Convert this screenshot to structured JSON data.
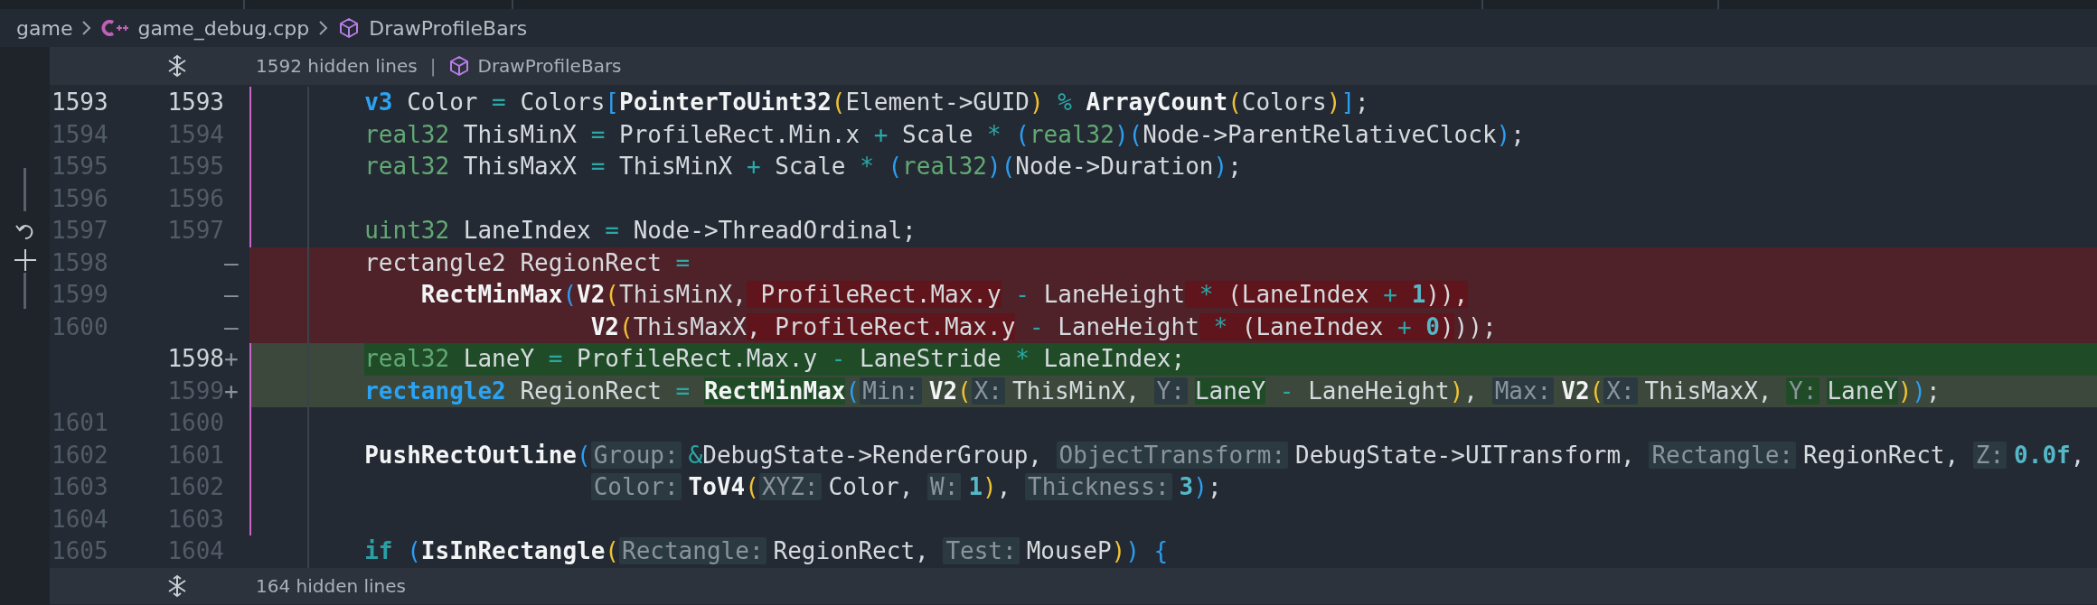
{
  "breadcrumb": [
    {
      "label": "game",
      "kind": "folder"
    },
    {
      "label": "game_debug.cpp",
      "kind": "file"
    },
    {
      "label": "DrawProfileBars",
      "kind": "symbol"
    }
  ],
  "hidden_top": {
    "text": "1592 hidden lines",
    "separator": "|",
    "symbol": "DrawProfileBars"
  },
  "lines": [
    {
      "old": "1593",
      "new": "1593",
      "kind": "statement",
      "removed": false,
      "added": false,
      "active": true,
      "marked": true,
      "tokens": [
        {
          "text": "v3",
          "kind": "keyword"
        },
        {
          "text": " Color ",
          "kind": "text"
        },
        {
          "text": "=",
          "kind": "operator"
        },
        {
          "text": " Colors",
          "kind": "text"
        },
        {
          "text": "[",
          "kind": "paren2"
        },
        {
          "text": "PointerToUint32",
          "kind": "function"
        },
        {
          "text": "(",
          "kind": "paren1"
        },
        {
          "text": "Element->GUID",
          "kind": "text"
        },
        {
          "text": ")",
          "kind": "paren1"
        },
        {
          "text": " % ",
          "kind": "operator"
        },
        {
          "text": "ArrayCount",
          "kind": "function"
        },
        {
          "text": "(",
          "kind": "paren1"
        },
        {
          "text": "Colors",
          "kind": "text"
        },
        {
          "text": ")",
          "kind": "paren1"
        },
        {
          "text": "]",
          "kind": "paren2"
        },
        {
          "text": ";",
          "kind": "text"
        }
      ]
    },
    {
      "old": "1594",
      "new": "1594",
      "kind": "statement",
      "removed": false,
      "added": false,
      "active": false,
      "marked": true,
      "tokens": [
        {
          "text": "real32",
          "kind": "type"
        },
        {
          "text": " ThisMinX ",
          "kind": "text"
        },
        {
          "text": "=",
          "kind": "operator"
        },
        {
          "text": " ProfileRect.Min.x ",
          "kind": "text"
        },
        {
          "text": "+",
          "kind": "operator"
        },
        {
          "text": " Scale ",
          "kind": "text"
        },
        {
          "text": "* ",
          "kind": "operator"
        },
        {
          "text": "(",
          "kind": "paren2"
        },
        {
          "text": "real32",
          "kind": "type"
        },
        {
          "text": ")(",
          "kind": "paren2"
        },
        {
          "text": "Node->ParentRelativeClock",
          "kind": "text"
        },
        {
          "text": ")",
          "kind": "paren2"
        },
        {
          "text": ";",
          "kind": "text"
        }
      ]
    },
    {
      "old": "1595",
      "new": "1595",
      "kind": "statement",
      "removed": false,
      "added": false,
      "active": false,
      "marked": true,
      "tokens": [
        {
          "text": "real32",
          "kind": "type"
        },
        {
          "text": " ThisMaxX ",
          "kind": "text"
        },
        {
          "text": "=",
          "kind": "operator"
        },
        {
          "text": " ThisMinX ",
          "kind": "text"
        },
        {
          "text": "+",
          "kind": "operator"
        },
        {
          "text": " Scale ",
          "kind": "text"
        },
        {
          "text": "* ",
          "kind": "operator"
        },
        {
          "text": "(",
          "kind": "paren2"
        },
        {
          "text": "real32",
          "kind": "type"
        },
        {
          "text": ")(",
          "kind": "paren2"
        },
        {
          "text": "Node->Duration",
          "kind": "text"
        },
        {
          "text": ")",
          "kind": "paren2"
        },
        {
          "text": ";",
          "kind": "text"
        }
      ]
    },
    {
      "old": "1596",
      "new": "1596",
      "kind": "statement",
      "removed": false,
      "added": false,
      "active": false,
      "marked": true
    },
    {
      "old": "1597",
      "new": "1597",
      "kind": "statement",
      "removed": false,
      "added": false,
      "active": false,
      "marked": true,
      "tokens": [
        {
          "text": "uint32",
          "kind": "type"
        },
        {
          "text": " LaneIndex ",
          "kind": "text"
        },
        {
          "text": "=",
          "kind": "operator"
        },
        {
          "text": " Node->ThreadOrdinal;",
          "kind": "text"
        }
      ]
    },
    {
      "old": "1598",
      "mark": "—",
      "kind": "statement",
      "removed": true,
      "added": false,
      "active": false,
      "marked": false,
      "tokens": [
        {
          "text": "rectangle2 RegionRect ",
          "kind": "text",
          "changed": false
        },
        {
          "text": "=",
          "kind": "operator",
          "changed": false
        }
      ]
    },
    {
      "old": "1599",
      "mark": "—",
      "kind": "continuation",
      "removed": true,
      "added": false,
      "active": false,
      "marked": false,
      "tokens": [
        {
          "text": "RectMinMax",
          "kind": "function",
          "changed": false
        },
        {
          "text": "(",
          "kind": "paren2",
          "changed": false
        },
        {
          "text": "V2",
          "kind": "function",
          "changed": false
        },
        {
          "text": "(",
          "kind": "paren1",
          "changed": false
        },
        {
          "text": "ThisMinX,",
          "kind": "text",
          "changed": false
        },
        {
          "text": " ProfileRect.Max.y",
          "kind": "text",
          "changed": true
        },
        {
          "text": " - ",
          "kind": "operator",
          "changed": false
        },
        {
          "text": "LaneHeight",
          "kind": "text",
          "changed": false
        },
        {
          "text": " * ",
          "kind": "operator",
          "changed": true
        },
        {
          "text": "(LaneIndex ",
          "kind": "text",
          "changed": true
        },
        {
          "text": "+ ",
          "kind": "operator",
          "changed": true
        },
        {
          "text": "1",
          "kind": "number",
          "changed": true
        },
        {
          "text": ")),",
          "kind": "text",
          "changed": true
        }
      ]
    },
    {
      "old": "1600",
      "mark": "—",
      "kind": "aligned",
      "removed": true,
      "added": false,
      "active": false,
      "marked": false,
      "tokens": [
        {
          "text": "V2",
          "kind": "function",
          "changed": false
        },
        {
          "text": "(",
          "kind": "paren1",
          "changed": false
        },
        {
          "text": "ThisMaxX",
          "kind": "text",
          "changed": false
        },
        {
          "text": ", ProfileRect.Max.y",
          "kind": "text",
          "changed": true
        },
        {
          "text": " - ",
          "kind": "operator",
          "changed": false
        },
        {
          "text": "LaneHeight",
          "kind": "text",
          "changed": false
        },
        {
          "text": " * ",
          "kind": "operator",
          "changed": true
        },
        {
          "text": "(LaneIndex ",
          "kind": "text",
          "changed": true
        },
        {
          "text": "+ ",
          "kind": "operator",
          "changed": true
        },
        {
          "text": "0",
          "kind": "number",
          "changed": true
        },
        {
          "text": ")",
          "kind": "text",
          "changed": true
        },
        {
          "text": "));",
          "kind": "text",
          "changed": false
        }
      ]
    },
    {
      "new": "1598",
      "mark": "+",
      "kind": "statement",
      "removed": false,
      "added": true,
      "active": true,
      "marked": true,
      "changed": true,
      "tokens": [
        {
          "text": "real32",
          "kind": "type"
        },
        {
          "text": " LaneY ",
          "kind": "text"
        },
        {
          "text": "=",
          "kind": "operator"
        },
        {
          "text": " ProfileRect.Max.y ",
          "kind": "text"
        },
        {
          "text": "-",
          "kind": "operator"
        },
        {
          "text": " LaneStride ",
          "kind": "text"
        },
        {
          "text": "*",
          "kind": "operator"
        },
        {
          "text": " LaneIndex;",
          "kind": "text"
        }
      ]
    },
    {
      "new": "1599",
      "mark": "+",
      "kind": "statement",
      "removed": false,
      "added": true,
      "active": false,
      "marked": true,
      "changed": false,
      "tokens": [
        {
          "text": "rectangle2",
          "kind": "keyword",
          "changed": false
        },
        {
          "text": " RegionRect ",
          "kind": "text",
          "changed": false
        },
        {
          "text": "= ",
          "kind": "operator",
          "changed": false
        },
        {
          "text": "RectMinMax",
          "kind": "function",
          "changed": true
        },
        {
          "text": "(",
          "kind": "paren2",
          "changed": false
        },
        {
          "text": "Min:",
          "kind": "hint",
          "changed": false
        },
        {
          "text": "V2",
          "kind": "function",
          "changed": false
        },
        {
          "text": "(",
          "kind": "paren1",
          "changed": false
        },
        {
          "text": "X:",
          "kind": "hint",
          "changed": false
        },
        {
          "text": "ThisMinX, ",
          "kind": "text",
          "changed": false
        },
        {
          "text": "Y:",
          "kind": "hint",
          "changed": false
        },
        {
          "text": "LaneY",
          "kind": "text",
          "changed": true
        },
        {
          "text": " - ",
          "kind": "operator",
          "changed": false
        },
        {
          "text": "LaneHeight",
          "kind": "text",
          "changed": false
        },
        {
          "text": ")",
          "kind": "paren1",
          "changed": false
        },
        {
          "text": ", ",
          "kind": "text",
          "changed": false
        },
        {
          "text": "Max:",
          "kind": "hint",
          "changed": false
        },
        {
          "text": "V2",
          "kind": "function",
          "changed": false
        },
        {
          "text": "(",
          "kind": "paren1",
          "changed": false
        },
        {
          "text": "X:",
          "kind": "hint",
          "changed": false
        },
        {
          "text": "ThisMaxX, ",
          "kind": "text",
          "changed": false
        },
        {
          "text": "Y:",
          "kind": "hint",
          "changed": true
        },
        {
          "text": "LaneY",
          "kind": "text",
          "changed": true
        },
        {
          "text": ")",
          "kind": "paren1",
          "changed": false
        },
        {
          "text": ")",
          "kind": "paren2",
          "changed": false
        },
        {
          "text": ";",
          "kind": "text",
          "changed": false
        }
      ]
    },
    {
      "old": "1601",
      "new": "1600",
      "kind": "statement",
      "removed": false,
      "added": false,
      "active": false,
      "marked": true
    },
    {
      "old": "1602",
      "new": "1601",
      "kind": "statement",
      "removed": false,
      "added": false,
      "active": false,
      "marked": true,
      "tokens": [
        {
          "text": "PushRectOutline",
          "kind": "function"
        },
        {
          "text": "(",
          "kind": "paren2"
        },
        {
          "text": "Group:",
          "kind": "hint"
        },
        {
          "text": "&",
          "kind": "operator"
        },
        {
          "text": "DebugState->RenderGroup, ",
          "kind": "text"
        },
        {
          "text": "ObjectTransform:",
          "kind": "hint"
        },
        {
          "text": "DebugState->UITransform, ",
          "kind": "text"
        },
        {
          "text": "Rectangle:",
          "kind": "hint"
        },
        {
          "text": "RegionRect, ",
          "kind": "text"
        },
        {
          "text": "Z:",
          "kind": "hint"
        },
        {
          "text": "0.0f",
          "kind": "number"
        },
        {
          "text": ",",
          "kind": "text"
        }
      ]
    },
    {
      "old": "1603",
      "new": "1602",
      "kind": "aligned",
      "removed": false,
      "added": false,
      "active": false,
      "marked": true,
      "tokens": [
        {
          "text": "Color:",
          "kind": "hint"
        },
        {
          "text": "ToV4",
          "kind": "function"
        },
        {
          "text": "(",
          "kind": "paren1"
        },
        {
          "text": "XYZ:",
          "kind": "hint"
        },
        {
          "text": "Color, ",
          "kind": "text"
        },
        {
          "text": "W:",
          "kind": "hint"
        },
        {
          "text": "1",
          "kind": "number"
        },
        {
          "text": ")",
          "kind": "paren1"
        },
        {
          "text": ", ",
          "kind": "text"
        },
        {
          "text": "Thickness:",
          "kind": "hint"
        },
        {
          "text": "3",
          "kind": "number"
        },
        {
          "text": ")",
          "kind": "paren2"
        },
        {
          "text": ";",
          "kind": "text"
        }
      ]
    },
    {
      "old": "1604",
      "new": "1603",
      "kind": "statement",
      "removed": false,
      "added": false,
      "active": false,
      "marked": true
    },
    {
      "old": "1605",
      "new": "1604",
      "kind": "statement",
      "removed": false,
      "added": false,
      "active": false,
      "marked": false,
      "tokens": [
        {
          "text": "if",
          "kind": "control"
        },
        {
          "text": " (",
          "kind": "paren2"
        },
        {
          "text": "IsInRectangle",
          "kind": "function"
        },
        {
          "text": "(",
          "kind": "paren1"
        },
        {
          "text": "Rectangle:",
          "kind": "hint"
        },
        {
          "text": "RegionRect, ",
          "kind": "text"
        },
        {
          "text": "Test:",
          "kind": "hint"
        },
        {
          "text": "MouseP",
          "kind": "text"
        },
        {
          "text": ")",
          "kind": "paren1"
        },
        {
          "text": ") {",
          "kind": "paren2"
        }
      ]
    }
  ],
  "hidden_bottom": {
    "text": "164 hidden lines"
  }
}
